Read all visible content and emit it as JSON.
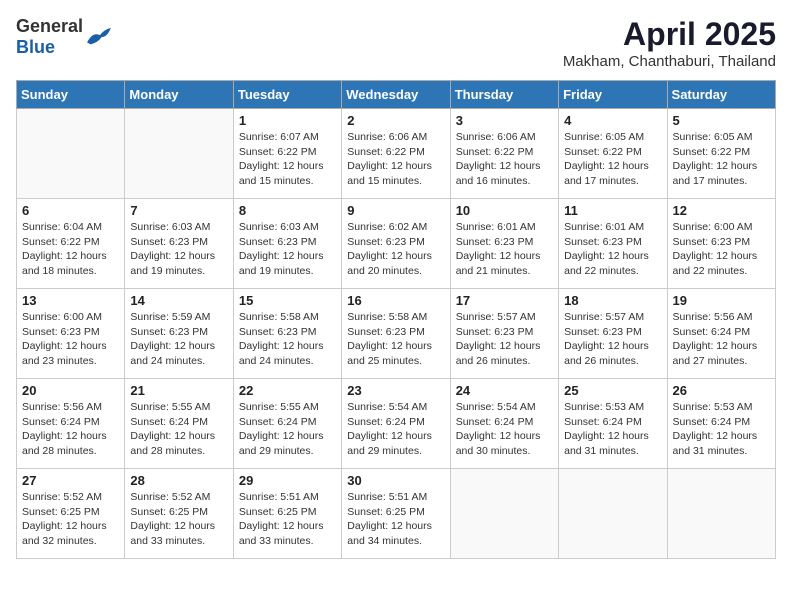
{
  "header": {
    "logo_general": "General",
    "logo_blue": "Blue",
    "month_title": "April 2025",
    "location": "Makham, Chanthaburi, Thailand"
  },
  "weekdays": [
    "Sunday",
    "Monday",
    "Tuesday",
    "Wednesday",
    "Thursday",
    "Friday",
    "Saturday"
  ],
  "weeks": [
    [
      {
        "day": "",
        "info": ""
      },
      {
        "day": "",
        "info": ""
      },
      {
        "day": "1",
        "info": "Sunrise: 6:07 AM\nSunset: 6:22 PM\nDaylight: 12 hours and 15 minutes."
      },
      {
        "day": "2",
        "info": "Sunrise: 6:06 AM\nSunset: 6:22 PM\nDaylight: 12 hours and 15 minutes."
      },
      {
        "day": "3",
        "info": "Sunrise: 6:06 AM\nSunset: 6:22 PM\nDaylight: 12 hours and 16 minutes."
      },
      {
        "day": "4",
        "info": "Sunrise: 6:05 AM\nSunset: 6:22 PM\nDaylight: 12 hours and 17 minutes."
      },
      {
        "day": "5",
        "info": "Sunrise: 6:05 AM\nSunset: 6:22 PM\nDaylight: 12 hours and 17 minutes."
      }
    ],
    [
      {
        "day": "6",
        "info": "Sunrise: 6:04 AM\nSunset: 6:22 PM\nDaylight: 12 hours and 18 minutes."
      },
      {
        "day": "7",
        "info": "Sunrise: 6:03 AM\nSunset: 6:23 PM\nDaylight: 12 hours and 19 minutes."
      },
      {
        "day": "8",
        "info": "Sunrise: 6:03 AM\nSunset: 6:23 PM\nDaylight: 12 hours and 19 minutes."
      },
      {
        "day": "9",
        "info": "Sunrise: 6:02 AM\nSunset: 6:23 PM\nDaylight: 12 hours and 20 minutes."
      },
      {
        "day": "10",
        "info": "Sunrise: 6:01 AM\nSunset: 6:23 PM\nDaylight: 12 hours and 21 minutes."
      },
      {
        "day": "11",
        "info": "Sunrise: 6:01 AM\nSunset: 6:23 PM\nDaylight: 12 hours and 22 minutes."
      },
      {
        "day": "12",
        "info": "Sunrise: 6:00 AM\nSunset: 6:23 PM\nDaylight: 12 hours and 22 minutes."
      }
    ],
    [
      {
        "day": "13",
        "info": "Sunrise: 6:00 AM\nSunset: 6:23 PM\nDaylight: 12 hours and 23 minutes."
      },
      {
        "day": "14",
        "info": "Sunrise: 5:59 AM\nSunset: 6:23 PM\nDaylight: 12 hours and 24 minutes."
      },
      {
        "day": "15",
        "info": "Sunrise: 5:58 AM\nSunset: 6:23 PM\nDaylight: 12 hours and 24 minutes."
      },
      {
        "day": "16",
        "info": "Sunrise: 5:58 AM\nSunset: 6:23 PM\nDaylight: 12 hours and 25 minutes."
      },
      {
        "day": "17",
        "info": "Sunrise: 5:57 AM\nSunset: 6:23 PM\nDaylight: 12 hours and 26 minutes."
      },
      {
        "day": "18",
        "info": "Sunrise: 5:57 AM\nSunset: 6:23 PM\nDaylight: 12 hours and 26 minutes."
      },
      {
        "day": "19",
        "info": "Sunrise: 5:56 AM\nSunset: 6:24 PM\nDaylight: 12 hours and 27 minutes."
      }
    ],
    [
      {
        "day": "20",
        "info": "Sunrise: 5:56 AM\nSunset: 6:24 PM\nDaylight: 12 hours and 28 minutes."
      },
      {
        "day": "21",
        "info": "Sunrise: 5:55 AM\nSunset: 6:24 PM\nDaylight: 12 hours and 28 minutes."
      },
      {
        "day": "22",
        "info": "Sunrise: 5:55 AM\nSunset: 6:24 PM\nDaylight: 12 hours and 29 minutes."
      },
      {
        "day": "23",
        "info": "Sunrise: 5:54 AM\nSunset: 6:24 PM\nDaylight: 12 hours and 29 minutes."
      },
      {
        "day": "24",
        "info": "Sunrise: 5:54 AM\nSunset: 6:24 PM\nDaylight: 12 hours and 30 minutes."
      },
      {
        "day": "25",
        "info": "Sunrise: 5:53 AM\nSunset: 6:24 PM\nDaylight: 12 hours and 31 minutes."
      },
      {
        "day": "26",
        "info": "Sunrise: 5:53 AM\nSunset: 6:24 PM\nDaylight: 12 hours and 31 minutes."
      }
    ],
    [
      {
        "day": "27",
        "info": "Sunrise: 5:52 AM\nSunset: 6:25 PM\nDaylight: 12 hours and 32 minutes."
      },
      {
        "day": "28",
        "info": "Sunrise: 5:52 AM\nSunset: 6:25 PM\nDaylight: 12 hours and 33 minutes."
      },
      {
        "day": "29",
        "info": "Sunrise: 5:51 AM\nSunset: 6:25 PM\nDaylight: 12 hours and 33 minutes."
      },
      {
        "day": "30",
        "info": "Sunrise: 5:51 AM\nSunset: 6:25 PM\nDaylight: 12 hours and 34 minutes."
      },
      {
        "day": "",
        "info": ""
      },
      {
        "day": "",
        "info": ""
      },
      {
        "day": "",
        "info": ""
      }
    ]
  ]
}
